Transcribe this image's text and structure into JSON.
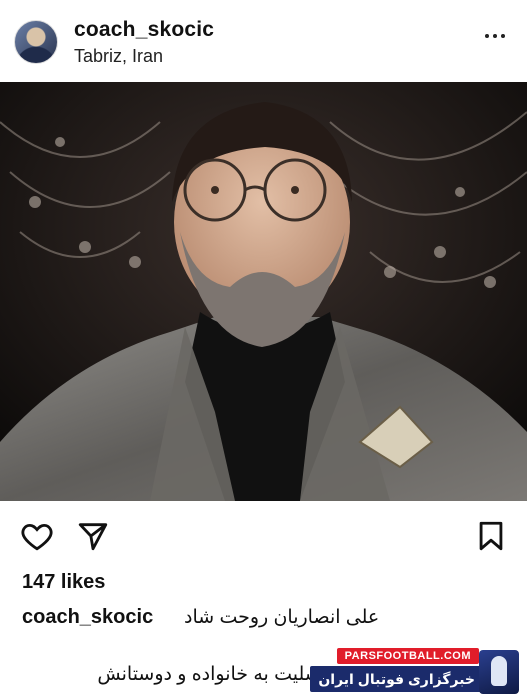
{
  "post": {
    "username": "coach_skocic",
    "location": "Tabriz, Iran",
    "likes": "147 likes",
    "caption_user": "coach_skocic",
    "caption_line1": "علی انصاریان روحت شاد",
    "caption_line2": "تسلیت به خانواده و دوستانش"
  },
  "watermark": {
    "site": "PARSFOOTBALL.COM",
    "tagline": "خبرگزاری فوتبال ایران"
  },
  "icons": [
    "more-options-icon",
    "heart-icon",
    "share-icon",
    "bookmark-icon"
  ],
  "colors": {
    "watermark_red": "#e11d2a",
    "watermark_blue": "#1b2b6b"
  }
}
